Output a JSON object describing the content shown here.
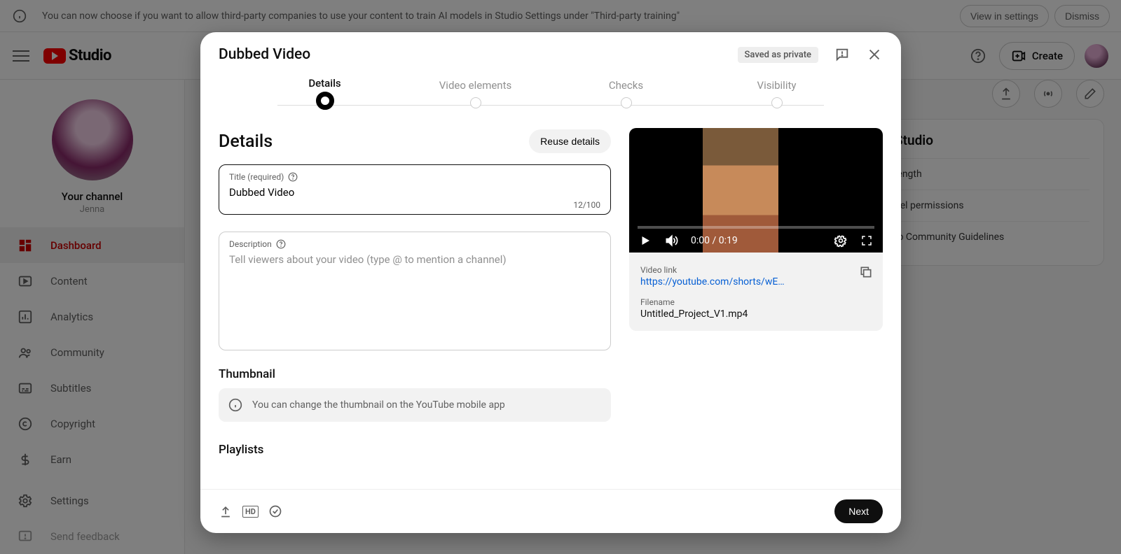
{
  "banner": {
    "text": "You can now choose if you want to allow third-party companies to use your content to train AI models in Studio Settings under \"Third-party training\"",
    "view_btn": "View in settings",
    "dismiss_btn": "Dismiss"
  },
  "header": {
    "logo_text": "Studio",
    "create_btn": "Create"
  },
  "sidebar": {
    "your_channel": "Your channel",
    "channel_name": "Jenna",
    "items": [
      {
        "label": "Dashboard"
      },
      {
        "label": "Content"
      },
      {
        "label": "Analytics"
      },
      {
        "label": "Community"
      },
      {
        "label": "Subtitles"
      },
      {
        "label": "Copyright"
      },
      {
        "label": "Earn"
      }
    ],
    "settings": "Settings",
    "feedback": "Send feedback"
  },
  "content_card": {
    "title": "Studio",
    "rows": [
      "length",
      "nel permissions",
      "to Community Guidelines"
    ]
  },
  "modal": {
    "title": "Dubbed Video",
    "badge": "Saved as private",
    "steps": [
      "Details",
      "Video elements",
      "Checks",
      "Visibility"
    ],
    "section_title": "Details",
    "reuse_btn": "Reuse details",
    "title_field": {
      "label": "Title (required)",
      "value": "Dubbed Video",
      "counter": "12/100"
    },
    "desc_field": {
      "label": "Description",
      "placeholder": "Tell viewers about your video (type @ to mention a channel)"
    },
    "thumbnail": {
      "heading": "Thumbnail",
      "info": "You can change the thumbnail on the YouTube mobile app"
    },
    "playlists_heading": "Playlists",
    "preview": {
      "time": "0:00 / 0:19",
      "link_label": "Video link",
      "link": "https://youtube.com/shorts/wE…",
      "filename_label": "Filename",
      "filename": "Untitled_Project_V1.mp4"
    },
    "next_btn": "Next"
  }
}
